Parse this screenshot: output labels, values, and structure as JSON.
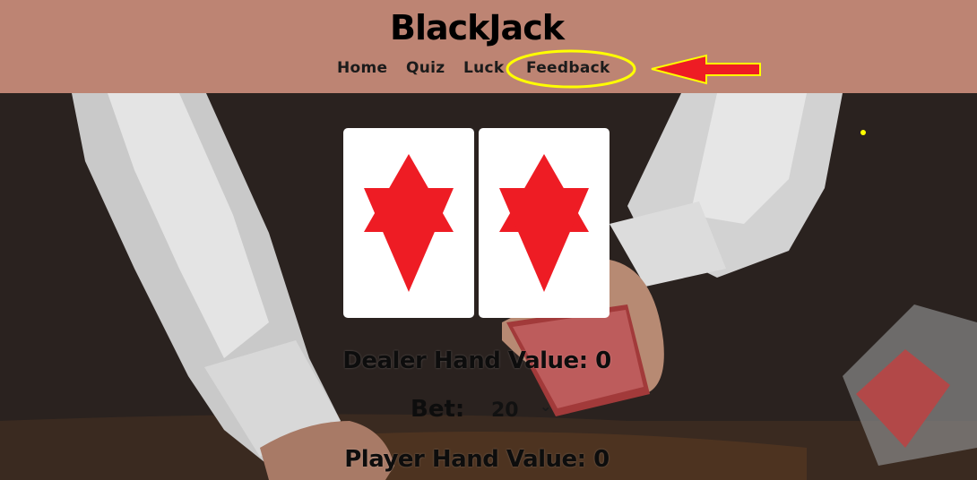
{
  "site": {
    "title": "BlackJack"
  },
  "nav": {
    "home": "Home",
    "quiz": "Quiz",
    "luck": "Luck",
    "feedback": "Feedback"
  },
  "game": {
    "dealer_label": "Dealer Hand Value:",
    "dealer_value": "0",
    "bet_label": "Bet:",
    "bet_value": "20",
    "player_label": "Player Hand Value:",
    "player_value": "0"
  },
  "cards": [
    {
      "face": "hidden",
      "icon": "star-of-david-icon"
    },
    {
      "face": "hidden",
      "icon": "star-of-david-icon"
    }
  ],
  "colors": {
    "header_bg": "#bd8473",
    "card_symbol": "#ee1c24",
    "annotation_yellow": "#ffff00",
    "annotation_red": "#ee1c24"
  }
}
